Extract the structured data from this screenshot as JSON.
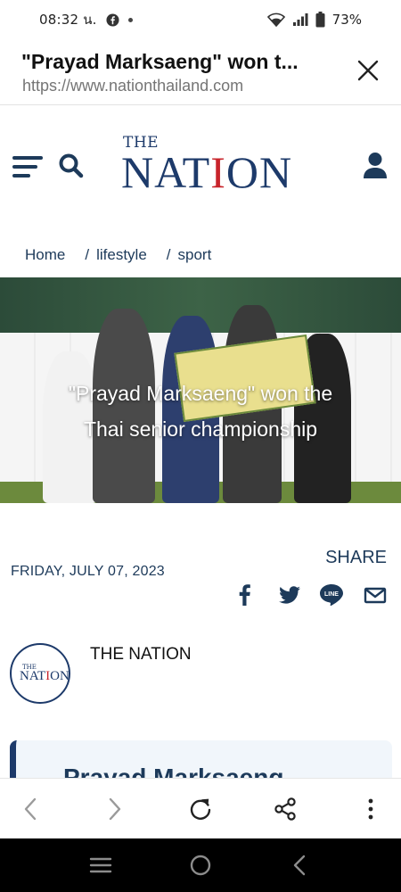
{
  "status_bar": {
    "time": "08:32 น.",
    "battery": "73%",
    "icons": [
      "facebook-icon",
      "dot-icon",
      "wifi-icon",
      "signal-icon",
      "battery-icon"
    ]
  },
  "tab": {
    "title": "\"Prayad Marksaeng\" won t...",
    "url": "https://www.nationthailand.com"
  },
  "site": {
    "logo_the": "THE",
    "logo_nation_pre": "NAT",
    "logo_nation_i": "I",
    "logo_nation_post": "ON",
    "accent_color": "#1d3a6a",
    "red_color": "#c8242b"
  },
  "breadcrumb": {
    "home": "Home",
    "sep1": "/",
    "lifestyle": "lifestyle",
    "sep2": "/",
    "sport": "sport"
  },
  "hero": {
    "headline_line1": "\"Prayad Marksaeng\" won the",
    "headline_line2": "Thai senior championship"
  },
  "article": {
    "date": "FRIDAY, JULY 07, 2023",
    "share_label": "SHARE",
    "share_icons": [
      "facebook-icon",
      "twitter-icon",
      "line-icon",
      "mail-icon"
    ],
    "line_label": "LINE",
    "author": "THE NATION",
    "author_avatar_the": "THE",
    "author_avatar_nat": "NAT",
    "author_avatar_i": "I",
    "author_avatar_on": "ON",
    "card_headline": "Prayad Marksaeng"
  },
  "toolbar": {
    "icons": [
      "back-icon",
      "forward-icon",
      "reload-icon",
      "share-icon",
      "more-icon"
    ]
  },
  "navbar": {
    "icons": [
      "recents-icon",
      "home-icon",
      "back-icon"
    ]
  }
}
